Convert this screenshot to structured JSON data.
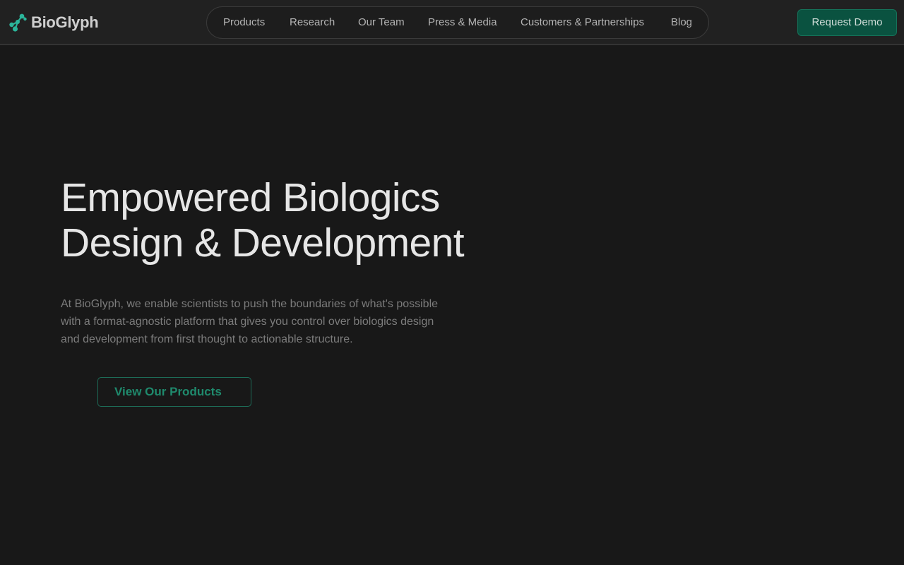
{
  "brand": {
    "name": "BioGlyph",
    "icon": "molecule-icon",
    "color": "#2bb59a"
  },
  "nav": {
    "items": [
      {
        "label": "Products"
      },
      {
        "label": "Research"
      },
      {
        "label": "Our Team"
      },
      {
        "label": "Press & Media"
      },
      {
        "label": "Customers & Partnerships"
      },
      {
        "label": "Blog"
      }
    ]
  },
  "header": {
    "demo_label": "Request Demo"
  },
  "hero": {
    "title_lines": [
      "Empowered Biologics",
      "Design & Development"
    ],
    "description_lines": [
      "At BioGlyph, we enable scientists to push the boundaries of what's possible",
      "with a format-agnostic platform that gives you control over biologics design",
      "and development from first thought to actionable structure."
    ],
    "cta_label": "View Our Products"
  },
  "colors": {
    "background": "#181818",
    "header_background": "#212121",
    "accent": "#0a5240",
    "accent_text": "#1f8a6d"
  }
}
